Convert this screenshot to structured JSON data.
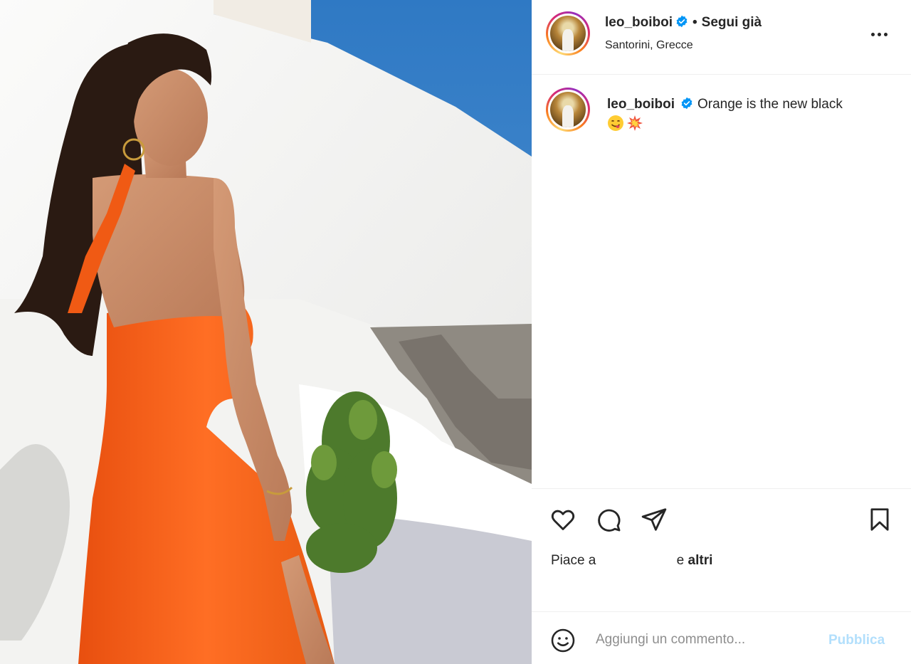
{
  "post": {
    "author": {
      "username": "leo_boiboi",
      "location": "Santorini, Grecce",
      "follow_status": "Segui già",
      "separator": "•"
    },
    "caption": {
      "username": "leo_boiboi",
      "text": "Orange is the new black",
      "emojis": [
        "smiling-face-savoring-food-emoji",
        "collision-emoji"
      ]
    },
    "likes": {
      "prefix": "Piace a",
      "middle": "e",
      "others": "altri"
    },
    "comment": {
      "placeholder": "Aggiungi un commento...",
      "publish_label": "Pubblica"
    },
    "colors": {
      "verified_blue": "#0095f6",
      "publish_disabled": "#b2dffc",
      "dress_orange": "#f2621c",
      "sky_blue": "#3a86c8"
    },
    "icons": {
      "like": "heart-icon",
      "comment": "comment-icon",
      "share": "paper-plane-icon",
      "save": "bookmark-icon",
      "emoji": "smiley-icon",
      "more": "more-options-icon"
    }
  }
}
